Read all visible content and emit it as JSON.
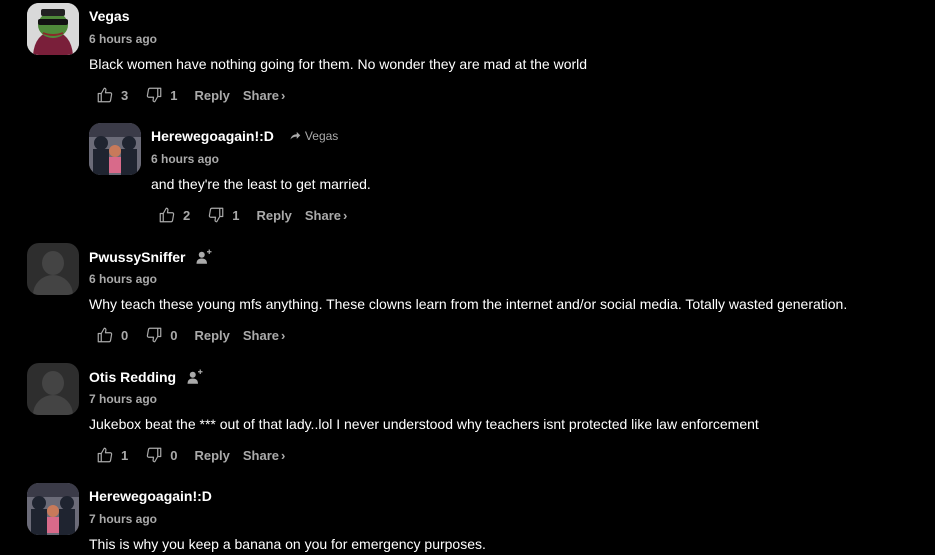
{
  "comments": [
    {
      "author": "Vegas",
      "time": "6 hours ago",
      "text": "Black women have nothing going for them. No wonder they are mad at the world",
      "likes": "3",
      "dislikes": "1",
      "reply_label": "Reply",
      "share_label": "Share",
      "share_chevron": "›"
    },
    {
      "author": "Herewegoagain!:D",
      "reply_to": "Vegas",
      "time": "6 hours ago",
      "text": "and they're the least to get married.",
      "likes": "2",
      "dislikes": "1",
      "reply_label": "Reply",
      "share_label": "Share",
      "share_chevron": "›"
    },
    {
      "author": "PwussySniffer",
      "time": "6 hours ago",
      "text": "Why teach these young mfs anything. These clowns learn from the internet and/or social media. Totally wasted generation.",
      "likes": "0",
      "dislikes": "0",
      "reply_label": "Reply",
      "share_label": "Share",
      "share_chevron": "›"
    },
    {
      "author": "Otis Redding",
      "time": "7 hours ago",
      "text": "Jukebox beat the *** out of that lady..lol I never understood why teachers isnt protected like law enforcement",
      "likes": "1",
      "dislikes": "0",
      "reply_label": "Reply",
      "share_label": "Share",
      "share_chevron": "›"
    },
    {
      "author": "Herewegoagain!:D",
      "time": "7 hours ago",
      "text": "This is why you keep a banana on you for emergency purposes."
    }
  ],
  "colors": {
    "background": "#000000",
    "text": "#ffffff",
    "muted": "#aaaaaa"
  }
}
